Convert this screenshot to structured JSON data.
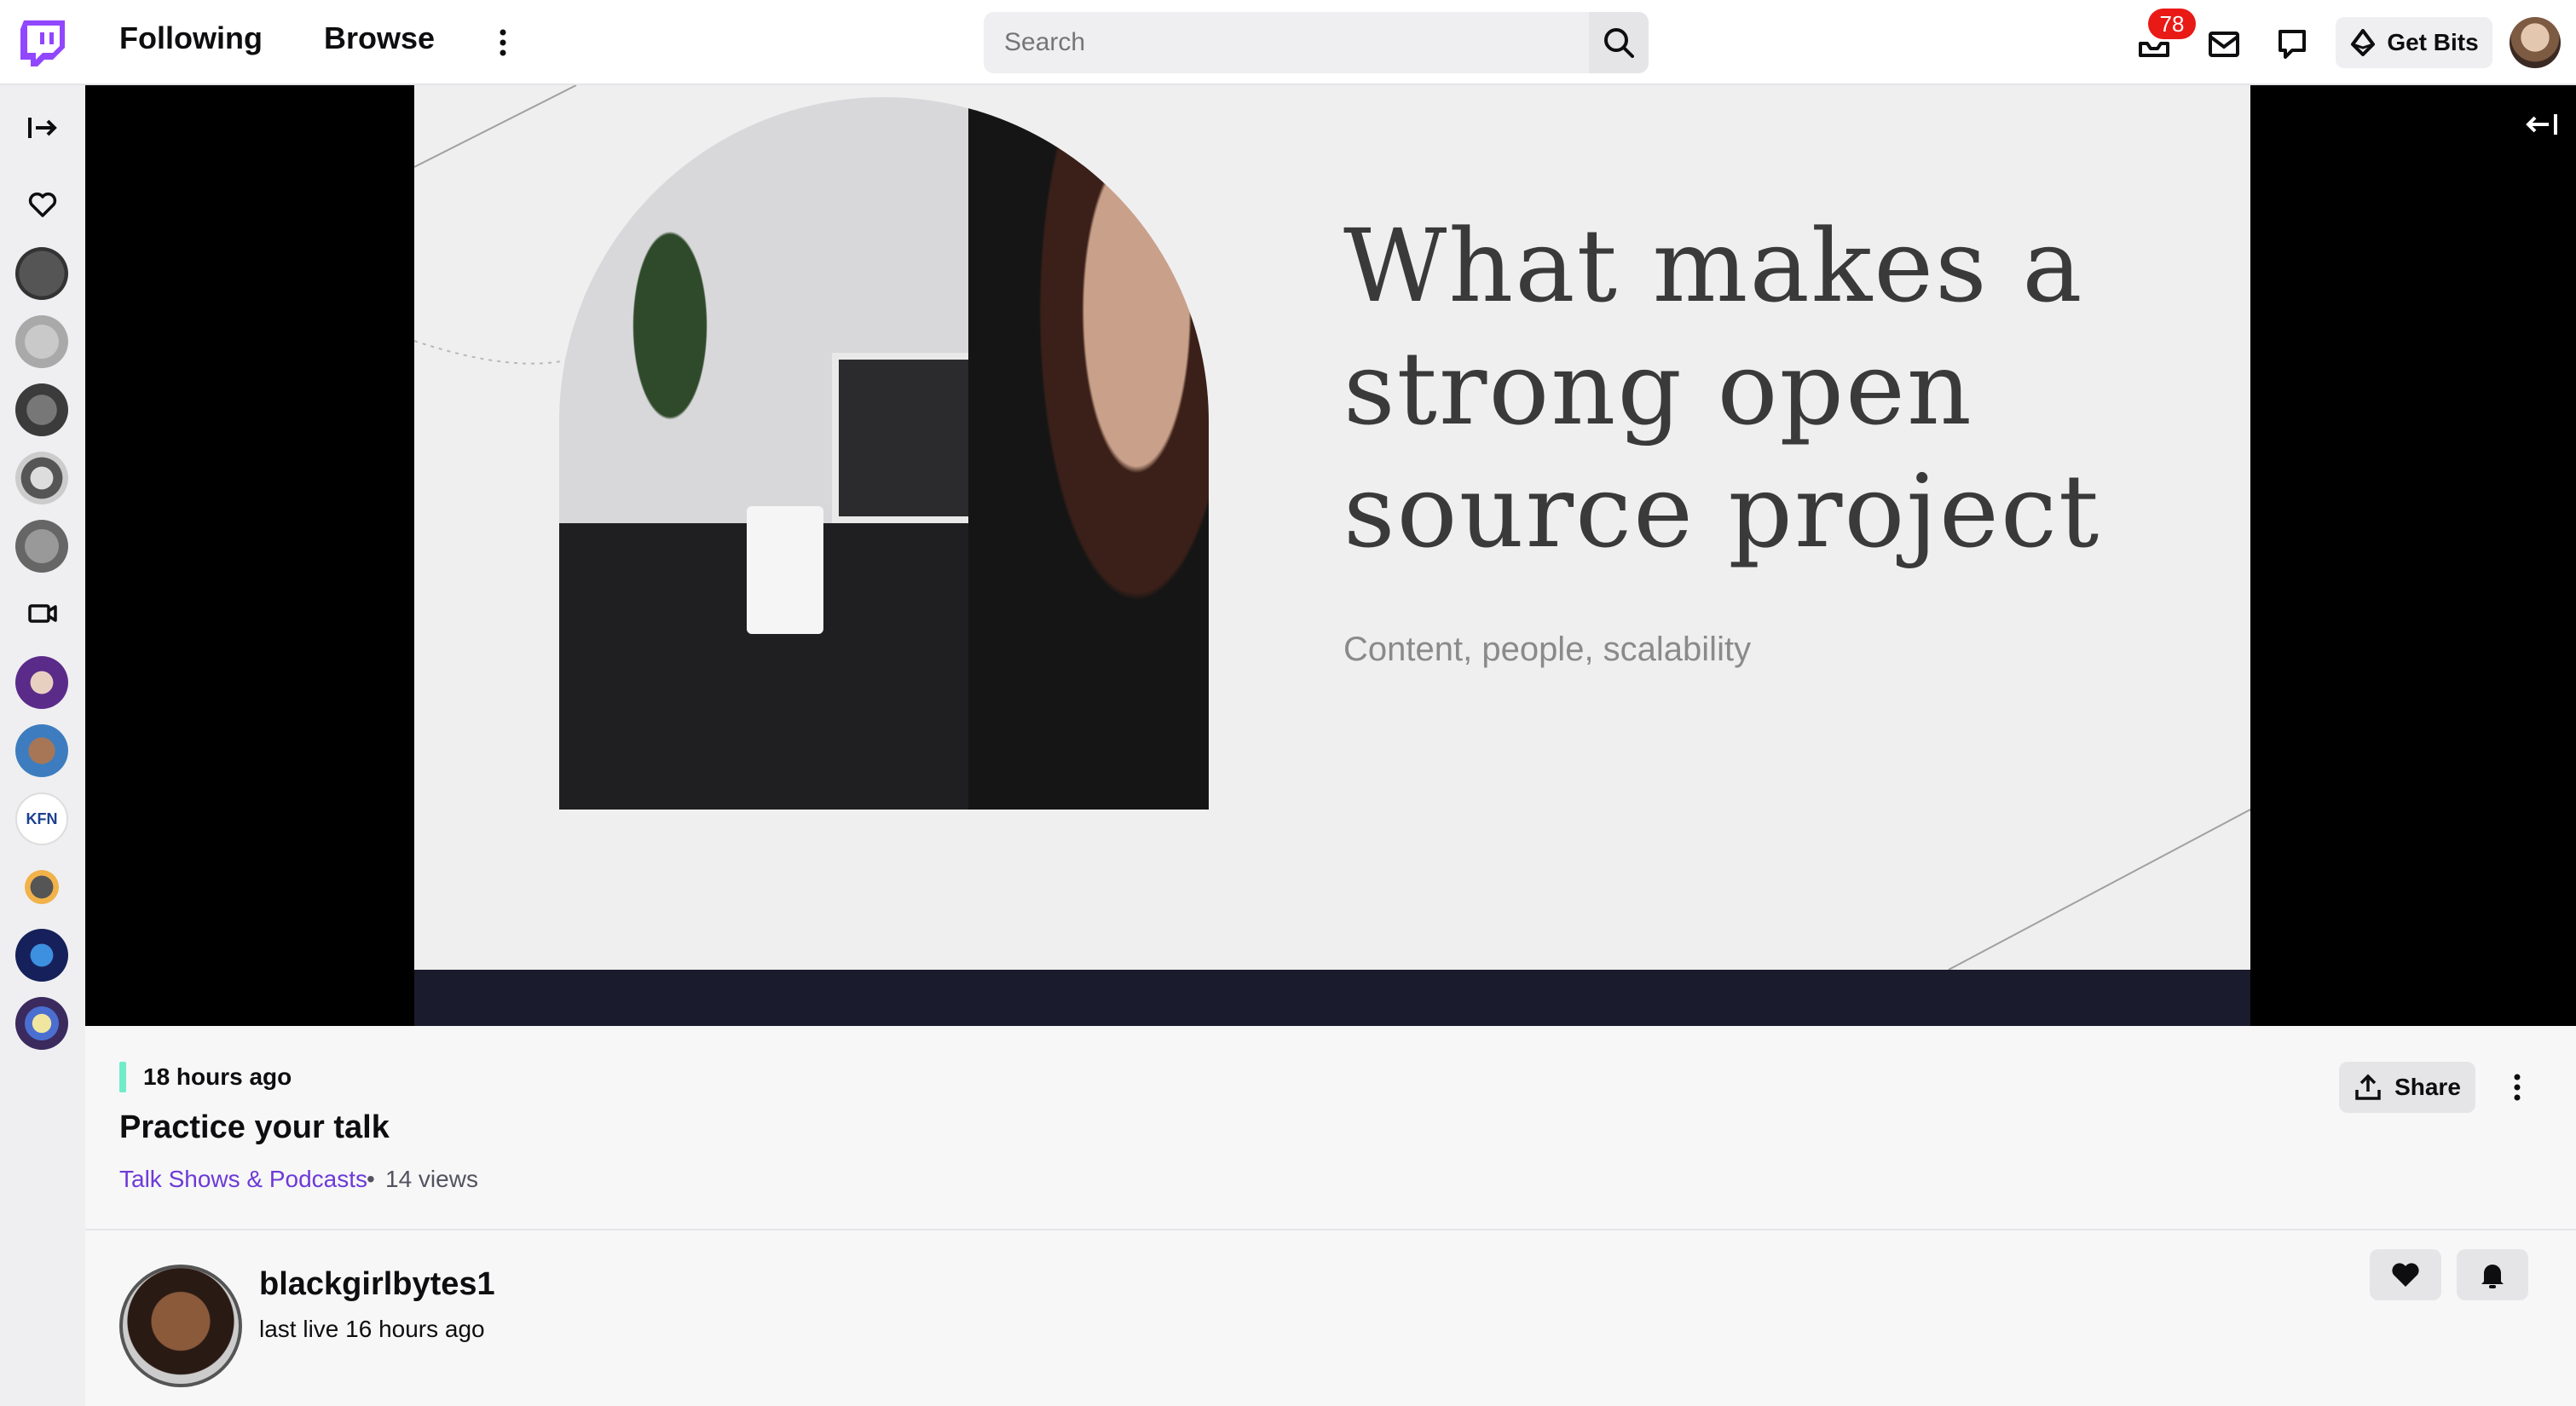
{
  "header": {
    "nav_following": "Following",
    "nav_browse": "Browse",
    "search_placeholder": "Search",
    "notification_count": "78",
    "get_bits_label": "Get Bits"
  },
  "video": {
    "slide_title_line1": "What makes a",
    "slide_title_line2": "strong open",
    "slide_title_line3": "source project",
    "slide_subtitle": "Content, people, scalability"
  },
  "info": {
    "time_ago": "18 hours ago",
    "title": "Practice your talk",
    "category": "Talk Shows & Podcasts",
    "separator": "•",
    "views": "14 views",
    "share_label": "Share"
  },
  "channel": {
    "name": "blackgirlbytes1",
    "last_live": "last live 16 hours ago"
  },
  "colors": {
    "brand": "#9146ff",
    "badge": "#e91916",
    "category_link": "#6d3ad6",
    "live_bar": "#71ecc8"
  }
}
